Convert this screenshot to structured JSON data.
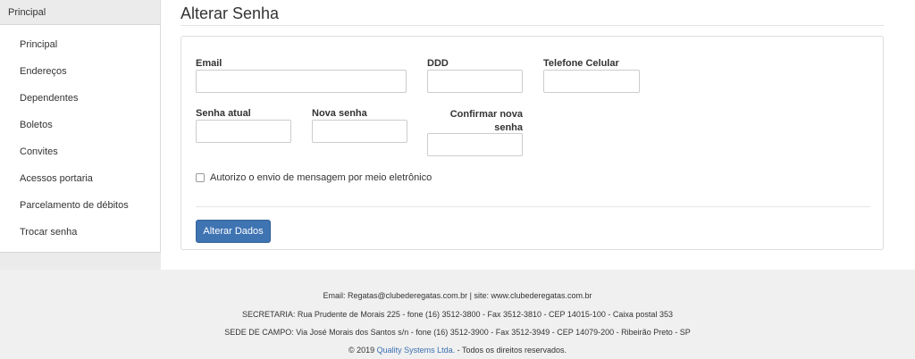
{
  "sidebar": {
    "header": "Principal",
    "items": [
      {
        "label": "Principal"
      },
      {
        "label": "Endereços"
      },
      {
        "label": "Dependentes"
      },
      {
        "label": "Boletos"
      },
      {
        "label": "Convites"
      },
      {
        "label": "Acessos portaria"
      },
      {
        "label": "Parcelamento de débitos"
      },
      {
        "label": "Trocar senha"
      }
    ]
  },
  "main": {
    "title": "Alterar Senha",
    "form": {
      "email_label": "Email",
      "ddd_label": "DDD",
      "phone_label": "Telefone Celular",
      "current_password_label": "Senha atual",
      "new_password_label": "Nova senha",
      "confirm_password_label_line1": "Confirmar nova",
      "confirm_password_label_line2": "senha",
      "consent_label": "Autorizo o envio de mensagem por meio eletrônico",
      "submit_label": "Alterar Dados"
    }
  },
  "footer": {
    "line1": "Email: Regatas@clubederegatas.com.br | site: www.clubederegatas.com.br",
    "line2": "SECRETARIA: Rua Prudente de Morais 225 - fone (16) 3512-3800 - Fax 3512-3810 - CEP 14015-100 - Caixa postal 353",
    "line3": "SEDE DE CAMPO: Via José Morais dos Santos s/n - fone (16) 3512-3900 - Fax 3512-3949 - CEP 14079-200 - Ribeirão Preto - SP",
    "copyright_prefix": "© 2019 ",
    "company_link": "Quality Systems Ltda.",
    "copyright_suffix": " - Todos os direitos reservados."
  },
  "colors": {
    "primary_button": "#3f74b3",
    "link": "#3a6fb0",
    "sidebar_header_bg": "#ebebeb",
    "page_bg": "#f0f0f0"
  }
}
